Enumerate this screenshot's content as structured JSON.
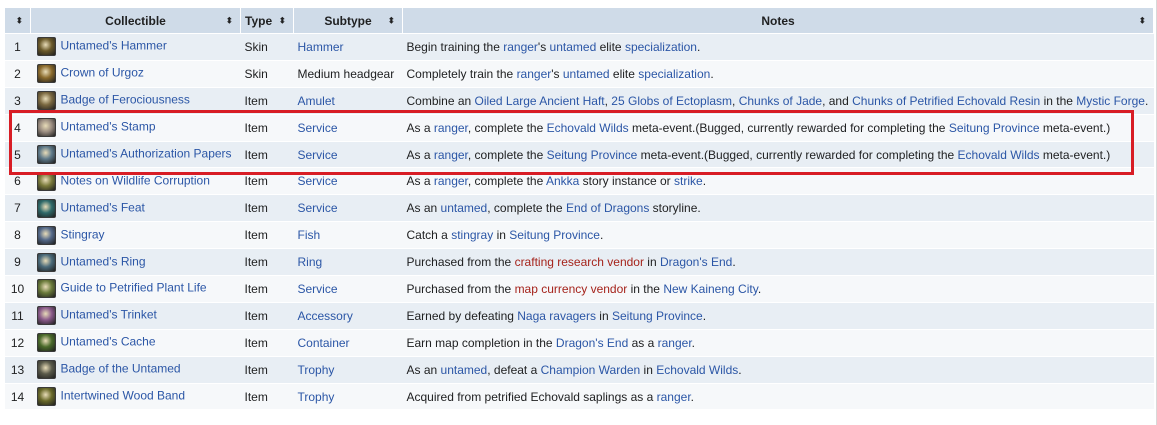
{
  "headers": {
    "num": "",
    "collectible": "Collectible",
    "type": "Type",
    "subtype": "Subtype",
    "notes": "Notes"
  },
  "sort_glyph": "⬍",
  "colors": {
    "header_bg": "#cfdbe8",
    "row_odd": "#e8eef4",
    "row_even": "#f6f8fa",
    "link": "#2b56a6",
    "redlink": "#a5231b",
    "highlight": "#d81d25"
  },
  "rows": [
    {
      "num": "1",
      "icon": "hammer-icon",
      "icon_color": "#6b5a2a",
      "name": "Untamed's Hammer",
      "type": "Skin",
      "subtype": "Hammer",
      "subtype_link": true,
      "notes": [
        {
          "t": "Begin training the "
        },
        {
          "t": "ranger",
          "l": 1
        },
        {
          "t": "'s "
        },
        {
          "t": "untamed",
          "l": 1
        },
        {
          "t": " elite "
        },
        {
          "t": "specialization",
          "l": 1
        },
        {
          "t": "."
        }
      ]
    },
    {
      "num": "2",
      "icon": "crown-icon",
      "icon_color": "#8a6a2c",
      "name": "Crown of Urgoz",
      "type": "Skin",
      "subtype": "Medium headgear",
      "subtype_link": false,
      "notes": [
        {
          "t": "Completely train the "
        },
        {
          "t": "ranger",
          "l": 1
        },
        {
          "t": "'s "
        },
        {
          "t": "untamed",
          "l": 1
        },
        {
          "t": " elite "
        },
        {
          "t": "specialization",
          "l": 1
        },
        {
          "t": "."
        }
      ]
    },
    {
      "num": "3",
      "icon": "badge-icon",
      "icon_color": "#7a6840",
      "name": "Badge of Ferociousness",
      "type": "Item",
      "subtype": "Amulet",
      "subtype_link": true,
      "notes": [
        {
          "t": "Combine an "
        },
        {
          "t": "Oiled Large Ancient Haft",
          "l": 1
        },
        {
          "t": ", "
        },
        {
          "t": "25 Globs of Ectoplasm",
          "l": 1
        },
        {
          "t": ", "
        },
        {
          "t": "Chunks of Jade",
          "l": 1
        },
        {
          "t": ", and "
        },
        {
          "t": "Chunks of Petrified Echovald Resin",
          "l": 1
        },
        {
          "t": " in the "
        },
        {
          "t": "Mystic Forge",
          "l": 1
        },
        {
          "t": "."
        }
      ]
    },
    {
      "num": "4",
      "icon": "stamp-icon",
      "icon_color": "#9a8c80",
      "name": "Untamed's Stamp",
      "type": "Item",
      "subtype": "Service",
      "subtype_link": true,
      "notes": [
        {
          "t": "As a "
        },
        {
          "t": "ranger",
          "l": 1
        },
        {
          "t": ", complete the "
        },
        {
          "t": "Echovald Wilds",
          "l": 1
        },
        {
          "t": " meta-event.(Bugged, currently rewarded for completing the "
        },
        {
          "t": "Seitung Province",
          "l": 1
        },
        {
          "t": " meta-event.)"
        }
      ]
    },
    {
      "num": "5",
      "icon": "papers-icon",
      "icon_color": "#5f7a8a",
      "name": "Untamed's Authorization Papers",
      "type": "Item",
      "subtype": "Service",
      "subtype_link": true,
      "notes": [
        {
          "t": "As a "
        },
        {
          "t": "ranger",
          "l": 1
        },
        {
          "t": ", complete the "
        },
        {
          "t": "Seitung Province",
          "l": 1
        },
        {
          "t": " meta-event.(Bugged, currently rewarded for completing the "
        },
        {
          "t": "Echovald Wilds",
          "l": 1
        },
        {
          "t": " meta-event.)"
        }
      ]
    },
    {
      "num": "6",
      "icon": "notes-icon",
      "icon_color": "#7a7a3a",
      "name": "Notes on Wildlife Corruption",
      "type": "Item",
      "subtype": "Service",
      "subtype_link": true,
      "notes": [
        {
          "t": "As a "
        },
        {
          "t": "ranger",
          "l": 1
        },
        {
          "t": ", complete the "
        },
        {
          "t": "Ankka",
          "l": 1
        },
        {
          "t": " story instance or "
        },
        {
          "t": "strike",
          "l": 1
        },
        {
          "t": "."
        }
      ]
    },
    {
      "num": "7",
      "icon": "feat-icon",
      "icon_color": "#2f6a6a",
      "name": "Untamed's Feat",
      "type": "Item",
      "subtype": "Service",
      "subtype_link": true,
      "notes": [
        {
          "t": "As an "
        },
        {
          "t": "untamed",
          "l": 1
        },
        {
          "t": ", complete the "
        },
        {
          "t": "End of Dragons",
          "l": 1
        },
        {
          "t": " storyline."
        }
      ]
    },
    {
      "num": "8",
      "icon": "stingray-icon",
      "icon_color": "#556a8a",
      "name": "Stingray",
      "type": "Item",
      "subtype": "Fish",
      "subtype_link": true,
      "notes": [
        {
          "t": "Catch a "
        },
        {
          "t": "stingray",
          "l": 1
        },
        {
          "t": " in "
        },
        {
          "t": "Seitung Province",
          "l": 1
        },
        {
          "t": "."
        }
      ]
    },
    {
      "num": "9",
      "icon": "ring-icon",
      "icon_color": "#4a6a7a",
      "name": "Untamed's Ring",
      "type": "Item",
      "subtype": "Ring",
      "subtype_link": true,
      "notes": [
        {
          "t": "Purchased from the "
        },
        {
          "t": "crafting research vendor",
          "r": 1
        },
        {
          "t": " in "
        },
        {
          "t": "Dragon's End",
          "l": 1
        },
        {
          "t": "."
        }
      ]
    },
    {
      "num": "10",
      "icon": "guide-icon",
      "icon_color": "#6a7a3a",
      "name": "Guide to Petrified Plant Life",
      "type": "Item",
      "subtype": "Service",
      "subtype_link": true,
      "notes": [
        {
          "t": "Purchased from the "
        },
        {
          "t": "map currency vendor",
          "r": 1
        },
        {
          "t": " in the "
        },
        {
          "t": "New Kaineng City",
          "l": 1
        },
        {
          "t": "."
        }
      ]
    },
    {
      "num": "11",
      "icon": "trinket-icon",
      "icon_color": "#8a5a8a",
      "name": "Untamed's Trinket",
      "type": "Item",
      "subtype": "Accessory",
      "subtype_link": true,
      "notes": [
        {
          "t": "Earned by defeating "
        },
        {
          "t": "Naga ravagers",
          "l": 1
        },
        {
          "t": " in "
        },
        {
          "t": "Seitung Province",
          "l": 1
        },
        {
          "t": "."
        }
      ]
    },
    {
      "num": "12",
      "icon": "cache-icon",
      "icon_color": "#4a6a2a",
      "name": "Untamed's Cache",
      "type": "Item",
      "subtype": "Container",
      "subtype_link": true,
      "notes": [
        {
          "t": "Earn map completion in the "
        },
        {
          "t": "Dragon's End",
          "l": 1
        },
        {
          "t": " as a "
        },
        {
          "t": "ranger",
          "l": 1
        },
        {
          "t": "."
        }
      ]
    },
    {
      "num": "13",
      "icon": "untamed-badge-icon",
      "icon_color": "#5a5a4a",
      "name": "Badge of the Untamed",
      "type": "Item",
      "subtype": "Trophy",
      "subtype_link": true,
      "notes": [
        {
          "t": "As an "
        },
        {
          "t": "untamed",
          "l": 1
        },
        {
          "t": ", defeat a "
        },
        {
          "t": "Champion Warden",
          "l": 1
        },
        {
          "t": " in "
        },
        {
          "t": "Echovald Wilds",
          "l": 1
        },
        {
          "t": "."
        }
      ]
    },
    {
      "num": "14",
      "icon": "wood-band-icon",
      "icon_color": "#6a6a2a",
      "name": "Intertwined Wood Band",
      "type": "Item",
      "subtype": "Trophy",
      "subtype_link": true,
      "notes": [
        {
          "t": "Acquired from petrified Echovald saplings as a "
        },
        {
          "t": "ranger",
          "l": 1
        },
        {
          "t": "."
        }
      ]
    }
  ]
}
